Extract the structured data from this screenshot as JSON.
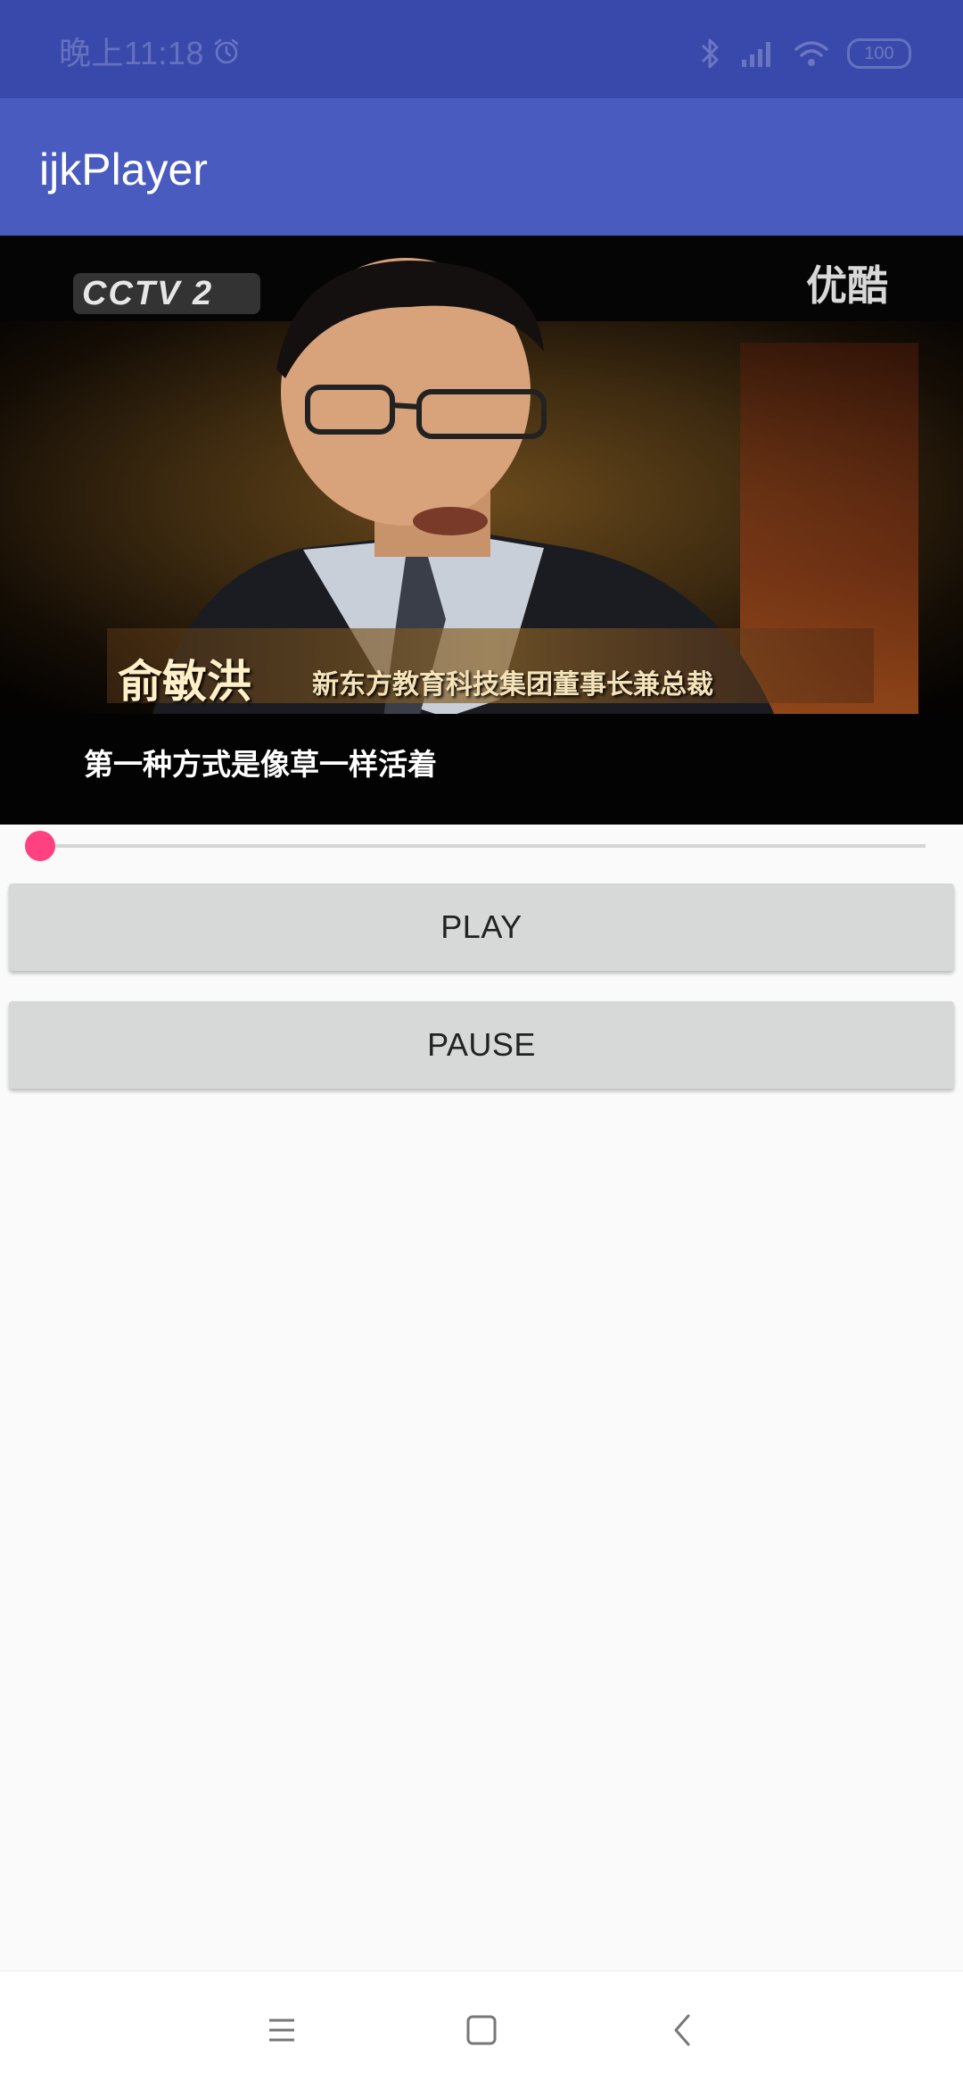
{
  "status_bar": {
    "time": "晚上11:18",
    "battery": "100",
    "icons": [
      "alarm-icon",
      "bluetooth-icon",
      "signal-icon",
      "wifi-icon",
      "battery-icon"
    ]
  },
  "app_bar": {
    "title": "ijkPlayer"
  },
  "video": {
    "channel_logo": "CCTV 2",
    "watermark": "优酷",
    "caption_name": "俞敏洪",
    "caption_title": "新东方教育科技集团董事长兼总裁",
    "subtitle": "第一种方式是像草一样活着"
  },
  "seekbar": {
    "progress": 0.0
  },
  "controls": {
    "play_label": "PLAY",
    "pause_label": "PAUSE"
  },
  "nav_bar": {
    "icons": [
      "menu-icon",
      "home-icon",
      "back-icon"
    ]
  },
  "colors": {
    "status_bar": "#3949ab",
    "app_bar": "#4a5bbf",
    "accent": "#ff4081",
    "button": "#d7d8d8",
    "background": "#fafafa"
  }
}
